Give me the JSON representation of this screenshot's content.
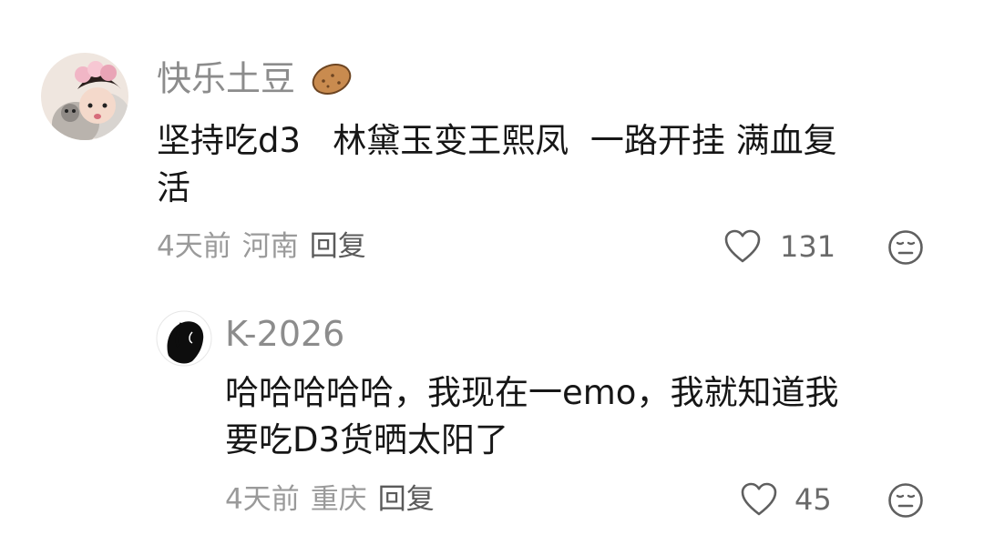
{
  "comments": [
    {
      "username": "快乐土豆",
      "username_emoji": "potato-icon",
      "text_line1": "坚持吃d3   林黛玉变王熙凤  一路开挂 满血复",
      "text_line2": "活",
      "time": "4天前",
      "location": "河南",
      "reply_label": "回复",
      "like_count": "131"
    },
    {
      "username": "K-2026",
      "text_line1": "哈哈哈哈哈，我现在一emo，我就知道我",
      "text_line2": "要吃D3货晒太阳了",
      "time": "4天前",
      "location": "重庆",
      "reply_label": "回复",
      "like_count": "45"
    }
  ],
  "colors": {
    "username": "#8c8c8c",
    "meta": "#9a9a9a",
    "text": "#161616"
  }
}
